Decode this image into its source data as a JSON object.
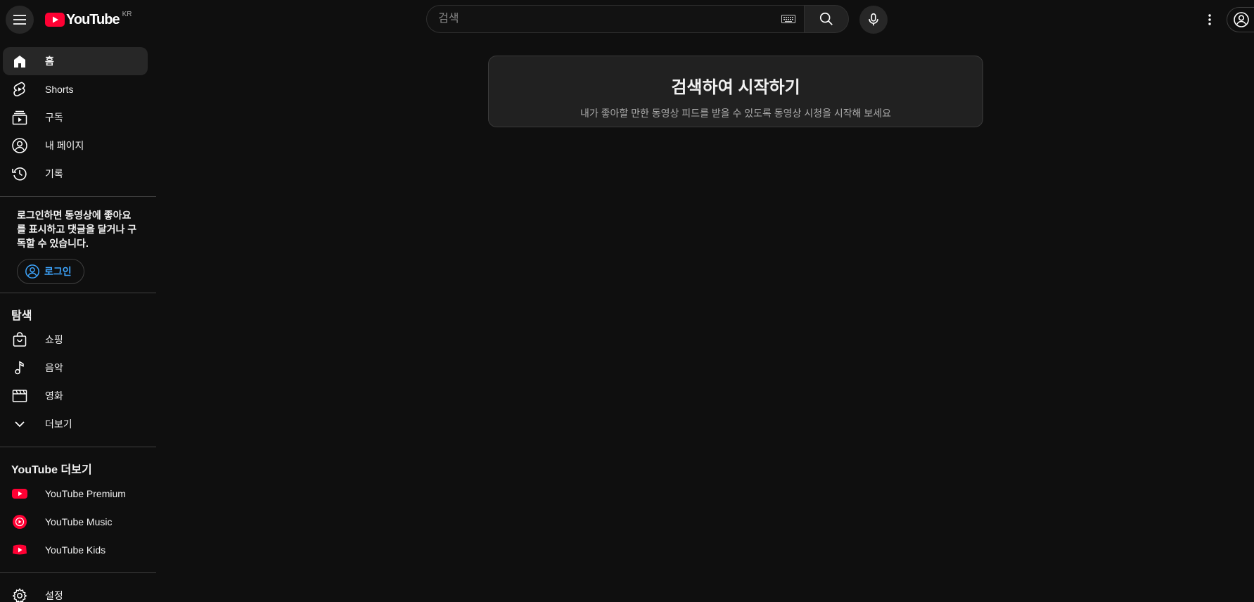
{
  "header": {
    "logo_text": "YouTube",
    "country_code": "KR",
    "search_placeholder": "검색"
  },
  "sidebar": {
    "main_items": [
      {
        "label": "홈",
        "icon": "home-icon"
      },
      {
        "label": "Shorts",
        "icon": "shorts-icon"
      },
      {
        "label": "구독",
        "icon": "subscriptions-icon"
      },
      {
        "label": "내 페이지",
        "icon": "profile-icon"
      },
      {
        "label": "기록",
        "icon": "history-icon"
      }
    ],
    "signin_prompt": "로그인하면 동영상에 좋아요를 표시하고 댓글을 달거나 구독할 수 있습니다.",
    "signin_label": "로그인",
    "explore_title": "탐색",
    "explore_items": [
      {
        "label": "쇼핑",
        "icon": "shopping-bag-icon"
      },
      {
        "label": "음악",
        "icon": "music-note-icon"
      },
      {
        "label": "영화",
        "icon": "film-icon"
      },
      {
        "label": "더보기",
        "icon": "chevron-down-icon"
      }
    ],
    "more_title": "YouTube 더보기",
    "more_items": [
      {
        "label": "YouTube Premium",
        "icon": "youtube-premium-icon"
      },
      {
        "label": "YouTube Music",
        "icon": "youtube-music-icon"
      },
      {
        "label": "YouTube Kids",
        "icon": "youtube-kids-icon"
      }
    ],
    "settings_label": "설정"
  },
  "main": {
    "empty_title": "검색하여 시작하기",
    "empty_subtitle": "내가 좋아할 만한 동영상 피드를 받을 수 있도록 동영상 시청을 시작해 보세요"
  },
  "colors": {
    "background": "#0f0f0f",
    "brand_red": "#ff0033",
    "link_blue": "#3ea6ff"
  }
}
